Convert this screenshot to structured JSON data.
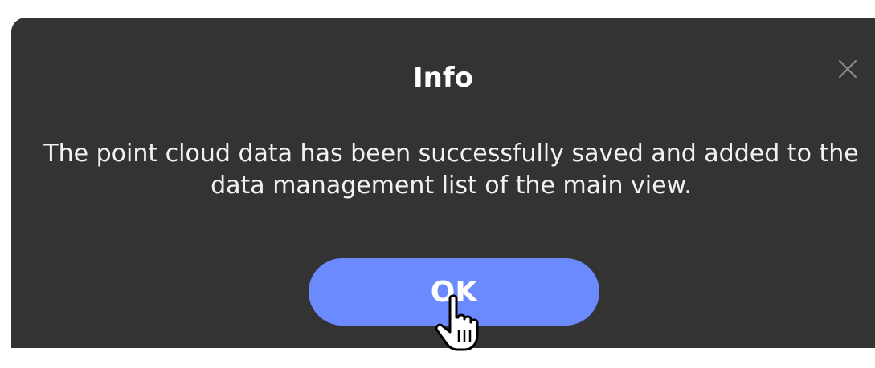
{
  "dialog": {
    "title": "Info",
    "message": "The point cloud data has been successfully saved and added to the data management list of the main view.",
    "close_icon": "close-icon",
    "ok_label": "OK"
  },
  "cursor": {
    "icon": "hand-pointer-icon"
  },
  "colors": {
    "dialog_background": "#333333",
    "button_accent": "#6b8afd",
    "text": "#ffffff"
  }
}
